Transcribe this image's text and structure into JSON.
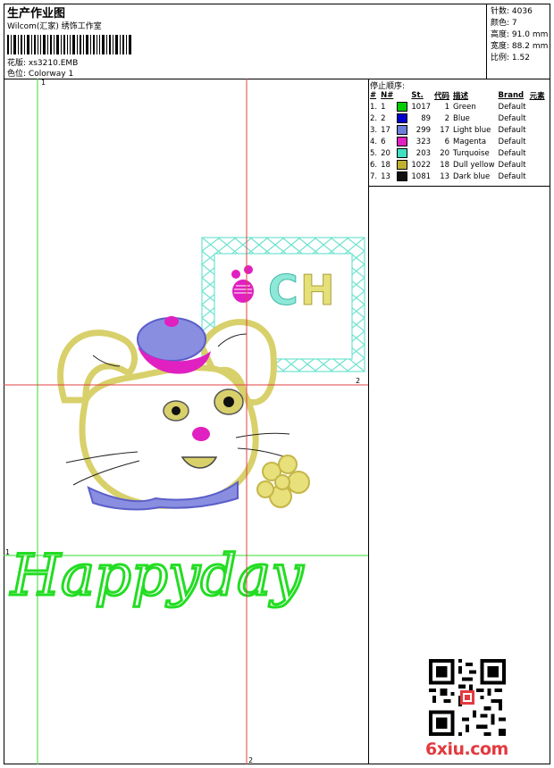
{
  "header": {
    "title": "生产作业图",
    "subtitle": "Wilcom(汇家) 绣饰工作室",
    "design_label": "花版:",
    "design_value": "xs3210.EMB",
    "color_label": "色位:",
    "color_value": "Colorway 1"
  },
  "stats": [
    {
      "label": "针数:",
      "value": "4036"
    },
    {
      "label": "颜色:",
      "value": "7"
    },
    {
      "label": "高度:",
      "value": "91.0 mm"
    },
    {
      "label": "宽度:",
      "value": "88.2 mm"
    },
    {
      "label": "比例:",
      "value": "1.52"
    }
  ],
  "stops": {
    "section_title": "停止顺序:",
    "columns": [
      "#",
      "N#",
      "St.",
      "代码",
      "描述",
      "Brand",
      "元素"
    ],
    "rows": [
      {
        "idx": "1.",
        "n": "1",
        "color": "#00cc00",
        "st": "1017",
        "code": "1",
        "desc": "Green",
        "brand": "Default"
      },
      {
        "idx": "2.",
        "n": "2",
        "color": "#0000cc",
        "st": "89",
        "code": "2",
        "desc": "Blue",
        "brand": "Default"
      },
      {
        "idx": "3.",
        "n": "17",
        "color": "#6b7fd8",
        "st": "299",
        "code": "17",
        "desc": "Light blue",
        "brand": "Default"
      },
      {
        "idx": "4.",
        "n": "6",
        "color": "#e020c0",
        "st": "323",
        "code": "6",
        "desc": "Magenta",
        "brand": "Default"
      },
      {
        "idx": "5.",
        "n": "20",
        "color": "#40e0c0",
        "st": "203",
        "code": "20",
        "desc": "Turquoise",
        "brand": "Default"
      },
      {
        "idx": "6.",
        "n": "18",
        "color": "#c0b030",
        "st": "1022",
        "code": "18",
        "desc": "Dull yellow",
        "brand": "Default"
      },
      {
        "idx": "7.",
        "n": "13",
        "color": "#101010",
        "st": "1081",
        "code": "13",
        "desc": "Dark blue",
        "brand": "Default"
      }
    ]
  },
  "artwork": {
    "letters": "CH",
    "text": "Happyday"
  },
  "guides": {
    "v1": "1",
    "h1": "1",
    "v2": "2",
    "h2": "2"
  },
  "watermark": "6xiu.com"
}
